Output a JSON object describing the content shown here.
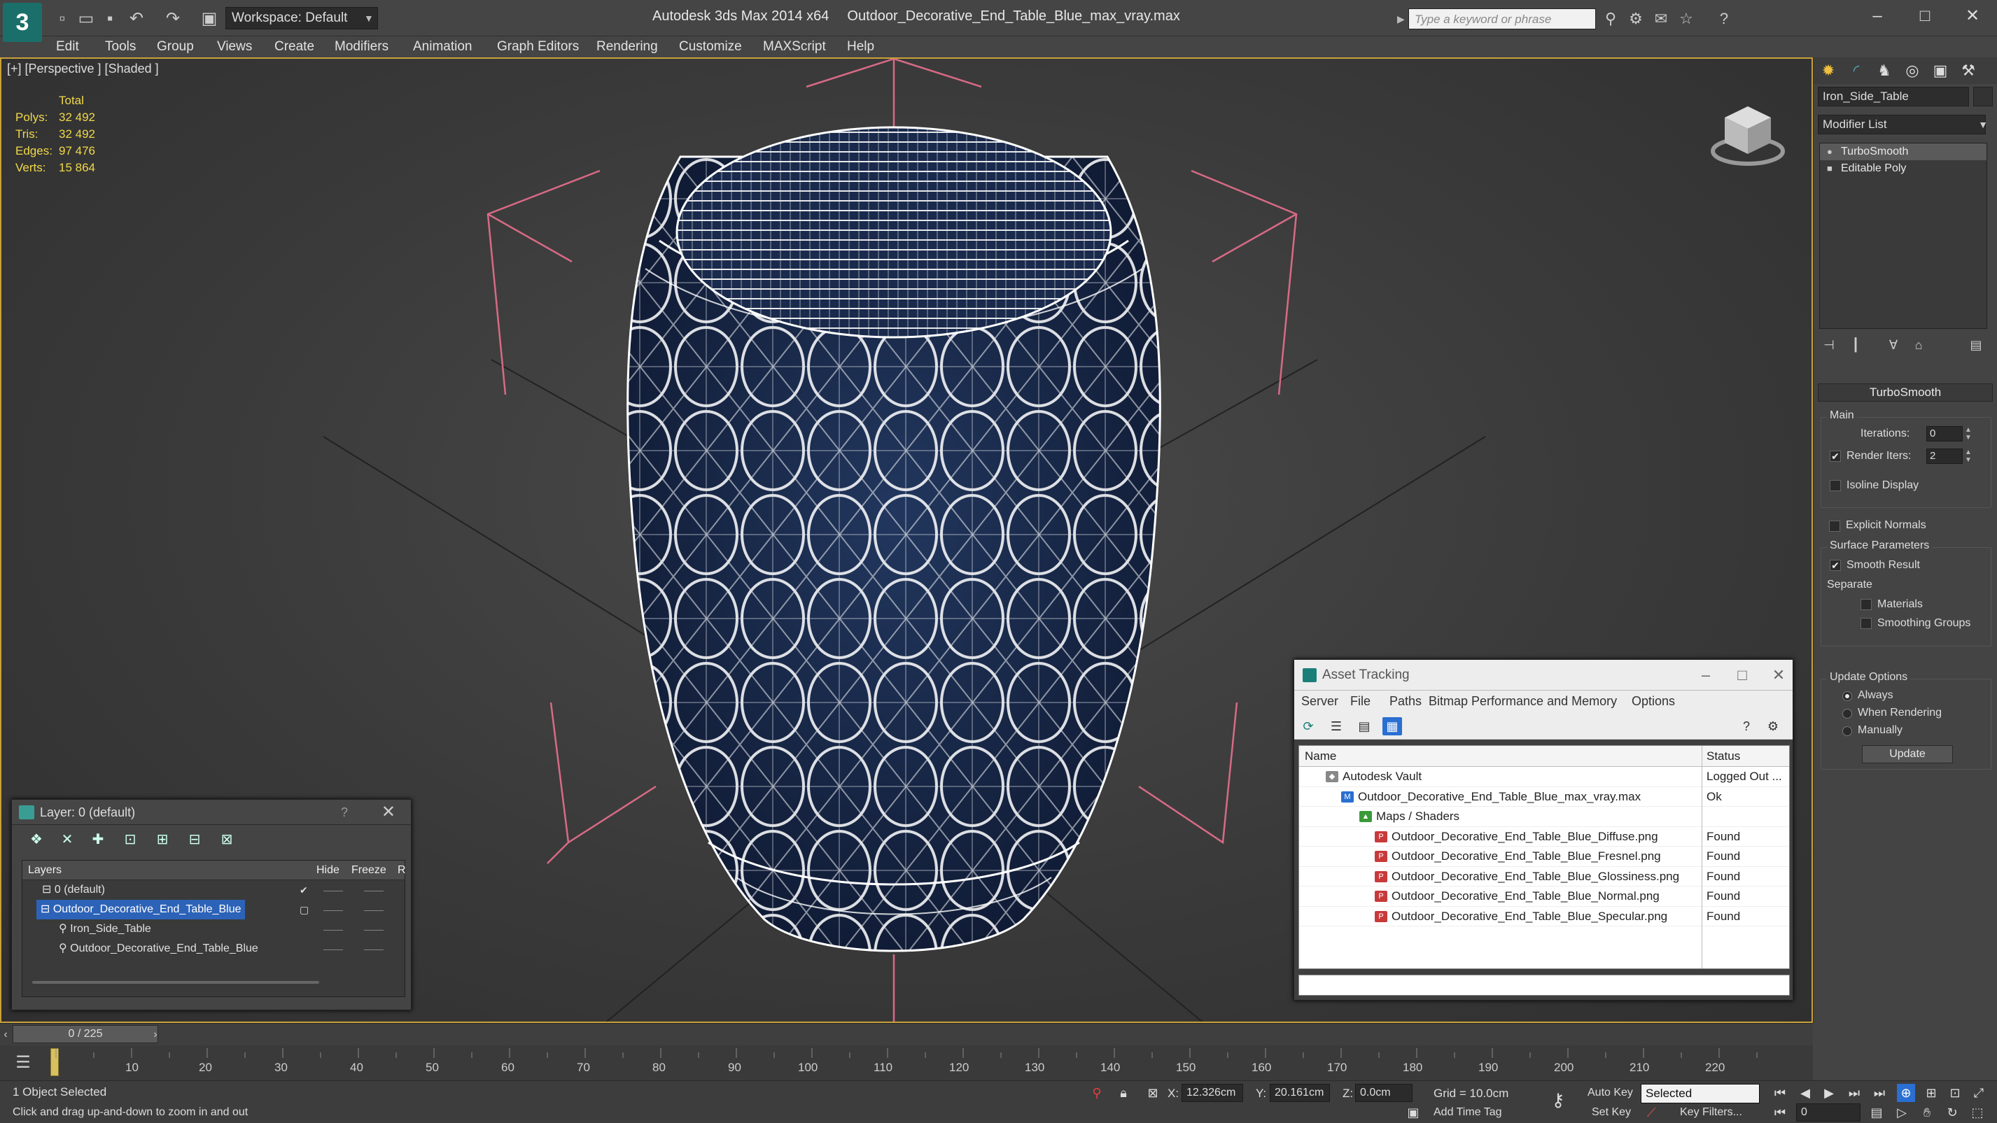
{
  "titlebar": {
    "app_name": "Autodesk 3ds Max  2014 x64",
    "file_name": "Outdoor_Decorative_End_Table_Blue_max_vray.max",
    "workspace": "Workspace: Default",
    "search_placeholder": "Type a keyword or phrase"
  },
  "menu": [
    "Edit",
    "Tools",
    "Group",
    "Views",
    "Create",
    "Modifiers",
    "Animation",
    "Graph Editors",
    "Rendering",
    "Customize",
    "MAXScript",
    "Help"
  ],
  "viewport": {
    "label": "[+] [Perspective ] [Shaded ]",
    "stats_total": "Total",
    "stats": [
      {
        "k": "Polys:",
        "v": "32 492"
      },
      {
        "k": "Tris:",
        "v": "32 492"
      },
      {
        "k": "Edges:",
        "v": "97 476"
      },
      {
        "k": "Verts:",
        "v": "15 864"
      }
    ]
  },
  "command_panel": {
    "object_name": "Iron_Side_Table",
    "modifier_list": "Modifier List",
    "stack": [
      "TurboSmooth",
      "Editable Poly"
    ],
    "rollout_title": "TurboSmooth",
    "main_group": "Main",
    "iterations_label": "Iterations:",
    "iterations_value": "0",
    "render_iters_label": "Render Iters:",
    "render_iters_value": "2",
    "isoline": "Isoline Display",
    "explicit_normals": "Explicit Normals",
    "surface_group": "Surface Parameters",
    "smooth_result": "Smooth Result",
    "separate": "Separate",
    "materials": "Materials",
    "smoothing_groups": "Smoothing Groups",
    "update_group": "Update Options",
    "always": "Always",
    "when_rendering": "When Rendering",
    "manually": "Manually",
    "update_button": "Update"
  },
  "layer_window": {
    "title": "Layer: 0 (default)",
    "help": "?",
    "col_layers": "Layers",
    "col_hide": "Hide",
    "col_freeze": "Freeze",
    "col_r": "R",
    "rows": [
      {
        "name": "0 (default)",
        "indent": 1
      },
      {
        "name": "Outdoor_Decorative_End_Table_Blue",
        "indent": 1
      },
      {
        "name": "Iron_Side_Table",
        "indent": 2
      },
      {
        "name": "Outdoor_Decorative_End_Table_Blue",
        "indent": 2
      }
    ]
  },
  "asset_window": {
    "title": "Asset Tracking",
    "menus": [
      "Server",
      "File",
      "Paths",
      "Bitmap Performance and Memory",
      "Options"
    ],
    "col_name": "Name",
    "col_status": "Status",
    "rows": [
      {
        "name": "Autodesk Vault",
        "status": "Logged Out ...",
        "indent": 1
      },
      {
        "name": "Outdoor_Decorative_End_Table_Blue_max_vray.max",
        "status": "Ok",
        "indent": 2
      },
      {
        "name": "Maps / Shaders",
        "status": "",
        "indent": 3
      },
      {
        "name": "Outdoor_Decorative_End_Table_Blue_Diffuse.png",
        "status": "Found",
        "indent": 4
      },
      {
        "name": "Outdoor_Decorative_End_Table_Blue_Fresnel.png",
        "status": "Found",
        "indent": 4
      },
      {
        "name": "Outdoor_Decorative_End_Table_Blue_Glossiness.png",
        "status": "Found",
        "indent": 4
      },
      {
        "name": "Outdoor_Decorative_End_Table_Blue_Normal.png",
        "status": "Found",
        "indent": 4
      },
      {
        "name": "Outdoor_Decorative_End_Table_Blue_Specular.png",
        "status": "Found",
        "indent": 4
      }
    ]
  },
  "timeline": {
    "slider": "0 / 225",
    "ticks": [
      "10",
      "20",
      "30",
      "40",
      "50",
      "60",
      "70",
      "80",
      "90",
      "100",
      "110",
      "120",
      "130",
      "140",
      "150",
      "160",
      "170",
      "180",
      "190",
      "200",
      "210",
      "220"
    ]
  },
  "status": {
    "selected": "1 Object Selected",
    "prompt": "Click and drag up-and-down to zoom in and out",
    "x_label": "X:",
    "x_value": "12.326cm",
    "y_label": "Y:",
    "y_value": "20.161cm",
    "z_label": "Z:",
    "z_value": "0.0cm",
    "grid": "Grid = 10.0cm",
    "add_time_tag": "Add Time Tag",
    "auto_key": "Auto Key",
    "set_key": "Set Key",
    "selected_dd": "Selected",
    "key_filters": "Key Filters...",
    "frame": "0"
  }
}
